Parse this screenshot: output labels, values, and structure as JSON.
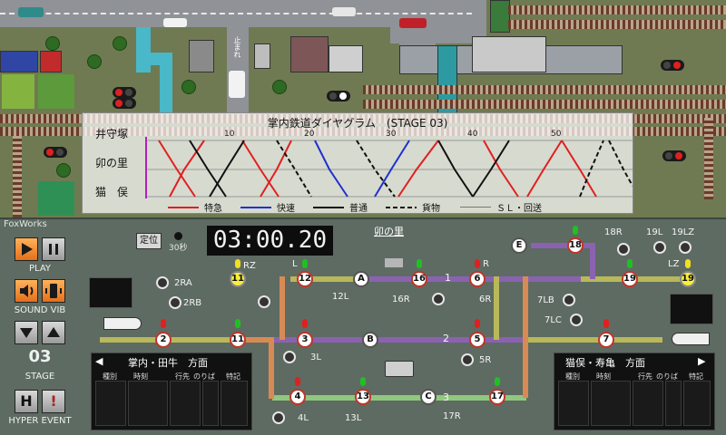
{
  "map": {
    "map_signs": [
      "止まれ"
    ]
  },
  "diagram": {
    "title": "掌内鉄道ダイヤグラム　(STAGE 03)",
    "stations": [
      "井守塚",
      "卯の里",
      "猫　俣"
    ],
    "ticks": [
      "10",
      "20",
      "30",
      "40",
      "50"
    ],
    "legend": [
      {
        "label": "特急",
        "color": "#e02020"
      },
      {
        "label": "快速",
        "color": "#2030d0"
      },
      {
        "label": "普通",
        "color": "#111111"
      },
      {
        "label": "貨物",
        "color": "#111111"
      },
      {
        "label": "ＳＬ・回送",
        "color": "#777777"
      }
    ]
  },
  "panel": {
    "brand": "FoxWorks",
    "play_label": "PLAY",
    "sound_label": "SOUND VIB",
    "stage_label": "STAGE",
    "stage_number": "03",
    "hyper_label": "HYPER EVENT",
    "hyper_h": "H",
    "hyper_ex": "!",
    "teiji": "定位",
    "sec30": "30秒",
    "clock": "03:00.20",
    "station_name": "卯の里"
  },
  "nodes": [
    "2",
    "11",
    "3",
    "4",
    "13",
    "17",
    "7",
    "5",
    "6",
    "16",
    "12",
    "18",
    "19",
    "19"
  ],
  "letters": [
    "A",
    "B",
    "C",
    "E"
  ],
  "track_numbers": [
    "1",
    "2",
    "3"
  ],
  "signal_labels": [
    "2RA",
    "2RB",
    "RZ",
    "L",
    "R",
    "12L",
    "16R",
    "6R",
    "7LB",
    "7LC",
    "5R",
    "3L",
    "4L",
    "13L",
    "17R",
    "18R",
    "19L",
    "19LZ",
    "LZ"
  ],
  "left_table": {
    "title": "掌内・田牛　方面",
    "columns": [
      "種別",
      "時刻",
      "行先",
      "のりば",
      "特記"
    ]
  },
  "right_table": {
    "title": "猫俣・寿亀　方面",
    "columns": [
      "種別",
      "時刻",
      "行先",
      "のりば",
      "特記"
    ]
  },
  "colors": {
    "track_main": "#b7b85a",
    "track_loop": "#8a62b0",
    "track_branch": "#d88a55",
    "track_green": "#8fc87e",
    "signal_red": "#e02020",
    "signal_green": "#20c020"
  }
}
